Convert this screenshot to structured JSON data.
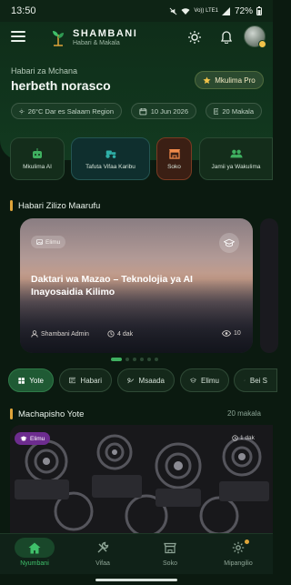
{
  "status_bar": {
    "time": "13:50",
    "network": "Vo)) LTE1",
    "battery": "72%"
  },
  "app": {
    "name": "SHAMBANI",
    "tagline": "Habari & Makala"
  },
  "user": {
    "greeting": "Habari za Mchana",
    "name": "herbeth norasco",
    "badge_label": "Mkulima Pro"
  },
  "info_chips": [
    {
      "icon": "sun-icon",
      "text": "26°C Dar es Salaam Region"
    },
    {
      "icon": "calendar-icon",
      "text": "10 Jun 2026"
    },
    {
      "icon": "document-icon",
      "text": "20 Makala"
    }
  ],
  "quick_actions": [
    {
      "label": "Mkulima AI",
      "icon": "robot-icon"
    },
    {
      "label": "Tafuta Vifaa Karibu",
      "icon": "tractor-icon"
    },
    {
      "label": "Soko",
      "icon": "store-icon",
      "active": true
    },
    {
      "label": "Jamii ya Wakulima",
      "icon": "community-icon"
    }
  ],
  "featured": {
    "section_title": "Habari Zilizo Maarufu",
    "category": "Elimu",
    "title": "Daktari wa Mazao – Teknolojia ya AI Inayosaidia Kilimo",
    "author": "Shambani Admin",
    "read_time": "4 dak",
    "views": "10",
    "slides": 6,
    "active_slide": 0
  },
  "filters": [
    {
      "label": "Yote",
      "icon": "grid-icon",
      "active": true
    },
    {
      "label": "Habari",
      "icon": "news-icon"
    },
    {
      "label": "Msaada",
      "icon": "help-icon"
    },
    {
      "label": "Elimu",
      "icon": "graduation-icon"
    },
    {
      "label": "Bei S",
      "icon": "trend-icon"
    }
  ],
  "posts": {
    "section_title": "Machapisho Yote",
    "count_label": "20 makala",
    "first_post": {
      "category": "Elimu",
      "time": "1 dak"
    }
  },
  "bottom_nav": [
    {
      "label": "Nyumbani",
      "icon": "home-icon",
      "active": true
    },
    {
      "label": "Vifaa",
      "icon": "tools-icon"
    },
    {
      "label": "Soko",
      "icon": "store-icon"
    },
    {
      "label": "Mipangilio",
      "icon": "settings-icon"
    }
  ],
  "colors": {
    "brand_green": "#1f5a34",
    "accent_gold": "#e0a53a",
    "active_green": "#3fc06a",
    "background": "#0b1a10"
  }
}
